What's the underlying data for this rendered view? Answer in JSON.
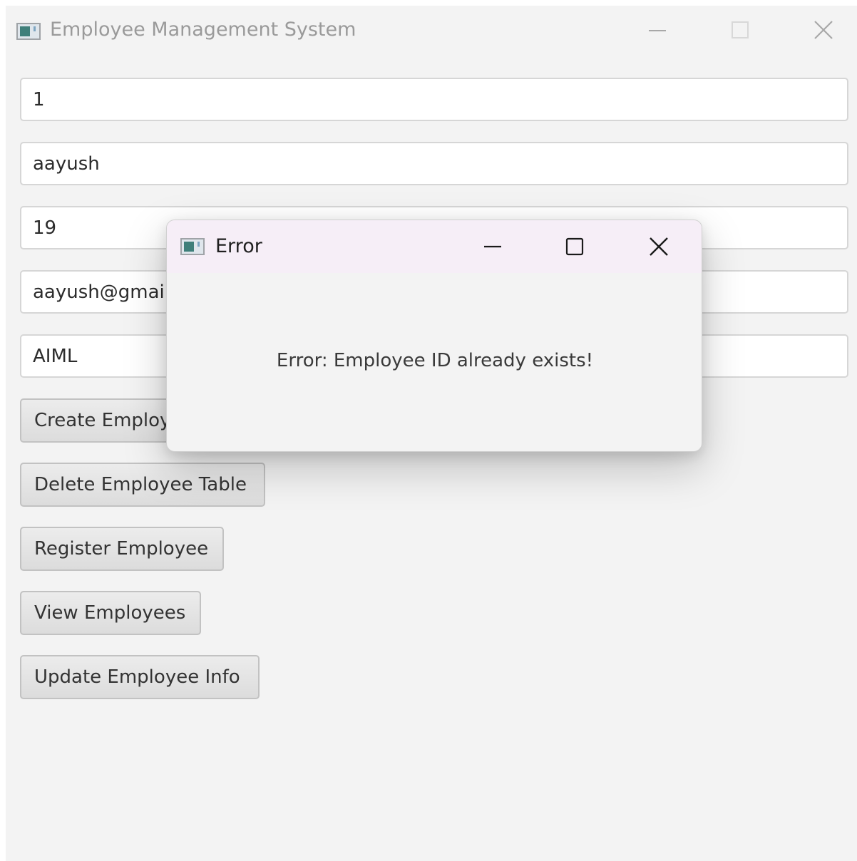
{
  "main_window": {
    "title": "Employee Management System",
    "icon": "app-window-icon",
    "caption_buttons": [
      "minimize-icon",
      "maximize-icon",
      "close-icon"
    ]
  },
  "form": {
    "id_value": "1",
    "name_value": "aayush",
    "age_value": "19",
    "email_value": "aayush@gmail.com",
    "department_value": "AIML"
  },
  "buttons": {
    "create": "Create Employee Table",
    "delete": "Delete Employee Table",
    "register": "Register Employee",
    "view": "View Employees",
    "update": "Update Employee Info"
  },
  "dialog": {
    "title": "Error",
    "icon": "app-window-icon",
    "message": "Error: Employee ID already exists!",
    "caption_buttons": [
      "minimize-icon",
      "maximize-icon",
      "close-icon"
    ]
  }
}
